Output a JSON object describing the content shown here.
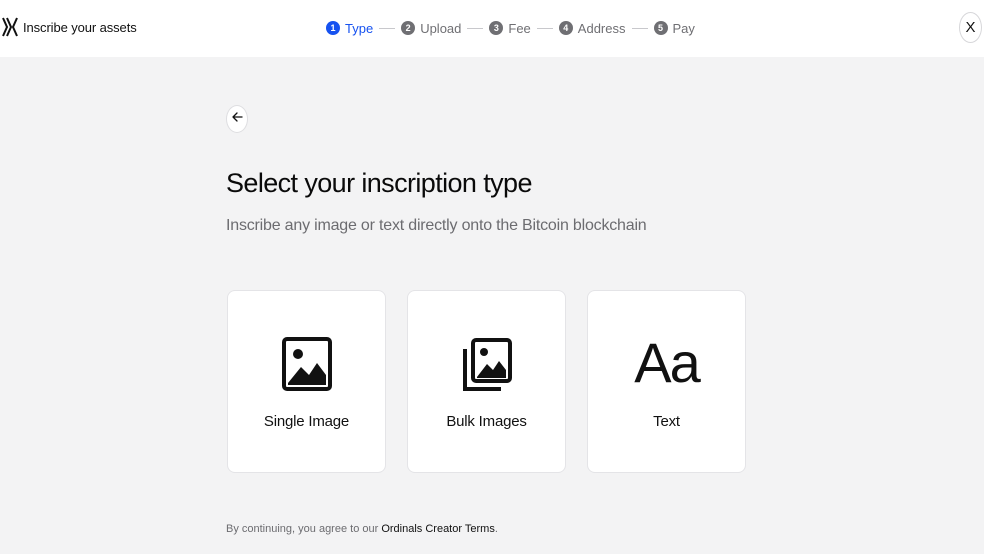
{
  "header": {
    "title": "Inscribe your assets",
    "close_label": "X"
  },
  "steps": [
    {
      "number": "1",
      "label": "Type",
      "active": true
    },
    {
      "number": "2",
      "label": "Upload",
      "active": false
    },
    {
      "number": "3",
      "label": "Fee",
      "active": false
    },
    {
      "number": "4",
      "label": "Address",
      "active": false
    },
    {
      "number": "5",
      "label": "Pay",
      "active": false
    }
  ],
  "main": {
    "title": "Select your inscription type",
    "subtitle": "Inscribe any image or text directly onto the Bitcoin blockchain",
    "options": [
      {
        "label": "Single Image",
        "icon": "image-icon"
      },
      {
        "label": "Bulk Images",
        "icon": "images-stack-icon"
      },
      {
        "label": "Text",
        "icon": "text-aa-icon",
        "glyph": "Aa"
      }
    ]
  },
  "footer": {
    "terms_prefix": "By continuing, you agree to our ",
    "terms_link": "Ordinals Creator Terms",
    "terms_suffix": "."
  },
  "colors": {
    "accent": "#1652f0",
    "background": "#f3f3f4",
    "card": "#ffffff",
    "muted_text": "#6c6c70"
  }
}
